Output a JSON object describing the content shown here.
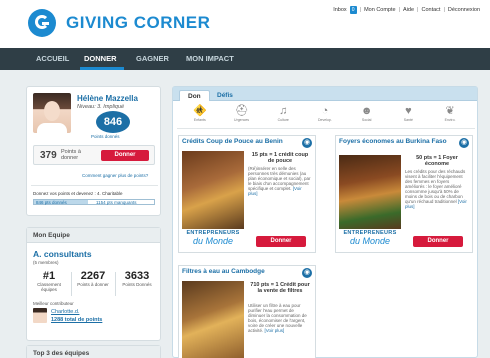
{
  "header": {
    "logo_text": "GIVING CORNER",
    "topnav": {
      "inbox": "Inbox",
      "inbox_count": "0",
      "account": "Mon Compte",
      "help": "Aide",
      "contact": "Contact",
      "logout": "Déconnexion"
    }
  },
  "nav": {
    "items": [
      "ACCUEIL",
      "DONNER",
      "GAGNER",
      "MON IMPACT"
    ],
    "active": "DONNER"
  },
  "profile": {
    "name": "Hélène Mazzella",
    "level": "Niveau: 3. Impliqué",
    "points": "846",
    "points_label": "Points donnés",
    "available_points": "379",
    "available_label": "Points à donner",
    "donate_button": "Donner",
    "earn_more": "Comment gagner plus de points?",
    "given_text": "Donnez vos points et devenez : 4. Charitable",
    "progress": {
      "fraction": 0.45,
      "left_label": "846 pts donnés",
      "right_label": "1154 pts manquants"
    }
  },
  "team": {
    "header": "Mon Equipe",
    "name": "A. consultants",
    "members": "(5 membres)",
    "stats": [
      {
        "value": "#1",
        "label": "Classement équipes"
      },
      {
        "value": "2267",
        "label": "Points à donner"
      },
      {
        "value": "3633",
        "label": "Points Donnés"
      }
    ],
    "best_label": "Meilleur contributeur",
    "best_name": "Charlotte.d.",
    "best_points": "1288 total de points"
  },
  "top_teams": {
    "header": "Top 3 des équipes"
  },
  "main": {
    "tabs": [
      "Don",
      "Défis"
    ],
    "active_tab": "Don",
    "categories": [
      {
        "icon": "child-icon",
        "glyph": "🚸",
        "label": "Enfants"
      },
      {
        "icon": "emergency-icon",
        "glyph": "⛑",
        "label": "Urgences"
      },
      {
        "icon": "culture-icon",
        "glyph": "♫",
        "label": "Culture"
      },
      {
        "icon": "development-icon",
        "glyph": "◔",
        "label": "Develop."
      },
      {
        "icon": "social-icon",
        "glyph": "☻",
        "label": "Social"
      },
      {
        "icon": "health-icon",
        "glyph": "♥",
        "label": "Santé"
      },
      {
        "icon": "environment-icon",
        "glyph": "❦",
        "label": "Enviro."
      }
    ],
    "cards": [
      {
        "title": "Crédits Coup de Pouce au Benin",
        "points": "15 pts = 1 crédit coup de pouce",
        "description": "(Ré)insérer en selle des personnes très démunies (au plan économique et social), par le biais d'un accompagnement spécifique et complet.",
        "more": "[Voir plus]",
        "org_line1": "ENTREPRENEURS",
        "org_line2": "du Monde",
        "button": "Donner"
      },
      {
        "title": "Foyers économes au Burkina Faso",
        "points": "50 pts = 1 Foyer économe",
        "description": "Les crédits pour des réchauds visent à faciliter l'équipement des femmes en foyers améliorés : le foyer amélioré consomme jusqu'à 50% de moins de bois ou de charbon qu'un réchaud traditionnel",
        "more": "[Voir plus]",
        "org_line1": "ENTREPRENEURS",
        "org_line2": "du Monde",
        "button": "Donner"
      },
      {
        "title": "Filtres à eau au Cambodge",
        "points": "710 pts = 1 Crédit pour la vente de filtres",
        "description": "Utiliser un filtre à eau pour purifier l'eau permet de diminuer la consommation de bois, économiser de l'argent, voire de créer une nouvelle activité.",
        "more": "[Voir plus]",
        "org_line1": "ENTREPRENEURS",
        "org_line2": "du Monde",
        "button": "Donner"
      }
    ]
  },
  "colors": {
    "brand_blue": "#1c8ad0",
    "nav_dark": "#2f3e46",
    "donate_red": "#d61a3c"
  }
}
